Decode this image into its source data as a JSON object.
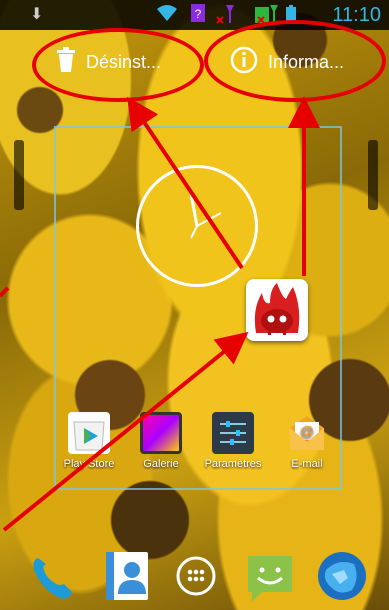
{
  "status_bar": {
    "time": "11:10",
    "icons": [
      "download-icon",
      "wifi-icon",
      "unknown-sim-icon",
      "signal-icon",
      "battery-icon"
    ]
  },
  "drop_targets": {
    "uninstall_label": "Désinst...",
    "info_label": "Informa..."
  },
  "apps": [
    {
      "label": "Play Store",
      "icon": "play-store-icon"
    },
    {
      "label": "Galerie",
      "icon": "gallery-icon"
    },
    {
      "label": "Paramètres",
      "icon": "settings-icon"
    },
    {
      "label": "E-mail",
      "icon": "email-icon"
    }
  ],
  "dock": [
    "phone-icon",
    "contacts-icon",
    "app-drawer-icon",
    "messaging-icon",
    "browser-icon"
  ],
  "colors": {
    "annotation": "#e60000",
    "status_accent": "#33b5e5",
    "frame": "#78c8e6"
  }
}
